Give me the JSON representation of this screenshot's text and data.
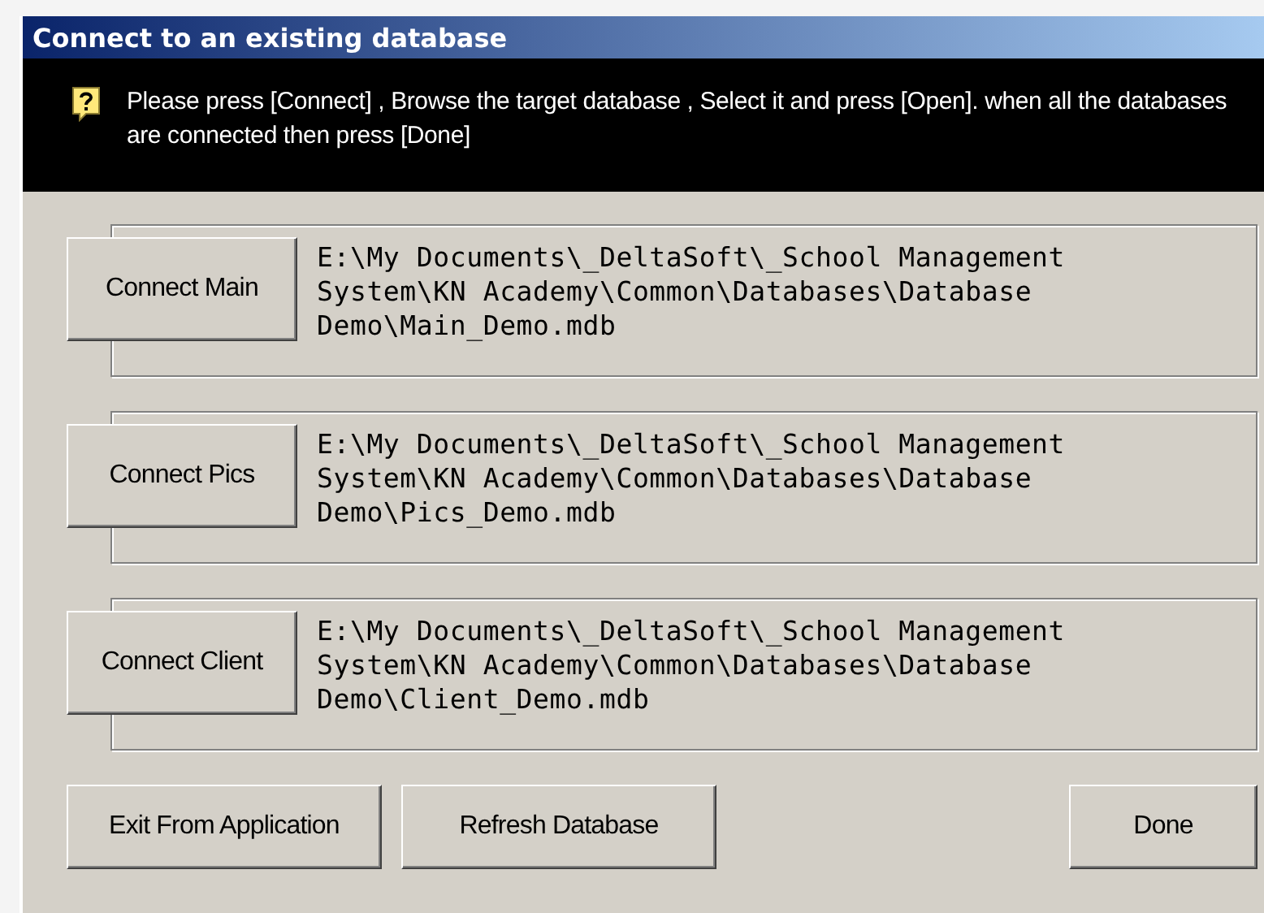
{
  "window": {
    "title": "Connect to an existing database"
  },
  "hint": {
    "text": "Please press [Connect] ,  Browse the target database , Select it and press [Open]. when all the databases are connected then press [Done]"
  },
  "connections": [
    {
      "button": "Connect Main",
      "path": "E:\\My Documents\\_DeltaSoft\\_School Management System\\KN Academy\\Common\\Databases\\Database Demo\\Main_Demo.mdb"
    },
    {
      "button": "Connect Pics",
      "path": "E:\\My Documents\\_DeltaSoft\\_School Management System\\KN Academy\\Common\\Databases\\Database Demo\\Pics_Demo.mdb"
    },
    {
      "button": "Connect Client",
      "path": "E:\\My Documents\\_DeltaSoft\\_School Management System\\KN Academy\\Common\\Databases\\Database Demo\\Client_Demo.mdb"
    }
  ],
  "left_buttons": [
    "Exit From Application",
    "Refresh Database"
  ],
  "right_button": "Done"
}
